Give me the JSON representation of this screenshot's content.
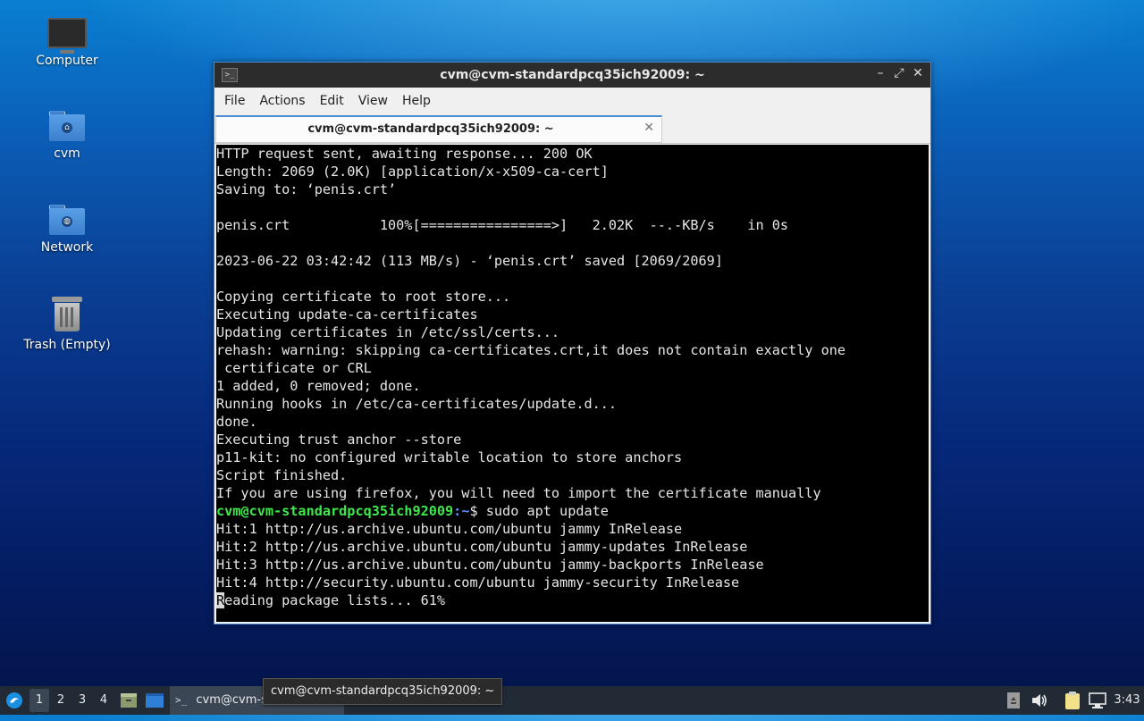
{
  "desktop": {
    "icons": [
      {
        "label": "Computer"
      },
      {
        "label": "cvm"
      },
      {
        "label": "Network"
      },
      {
        "label": "Trash (Empty)"
      }
    ]
  },
  "window": {
    "title": "cvm@cvm-standardpcq35ich92009: ~",
    "menu": [
      "File",
      "Actions",
      "Edit",
      "View",
      "Help"
    ],
    "tab_label": "cvm@cvm-standardpcq35ich92009: ~",
    "tab_close": "✕",
    "controls": {
      "minimize": "–",
      "maximize": "⤢",
      "close": "✕"
    }
  },
  "terminal": {
    "lines": [
      "HTTP request sent, awaiting response... 200 OK",
      "Length: 2069 (2.0K) [application/x-x509-ca-cert]",
      "Saving to: ‘penis.crt’",
      "",
      "penis.crt           100%[================>]   2.02K  --.-KB/s    in 0s",
      "",
      "2023-06-22 03:42:42 (113 MB/s) - ‘penis.crt’ saved [2069/2069]",
      "",
      "Copying certificate to root store...",
      "Executing update-ca-certificates",
      "Updating certificates in /etc/ssl/certs...",
      "rehash: warning: skipping ca-certificates.crt,it does not contain exactly one",
      " certificate or CRL",
      "1 added, 0 removed; done.",
      "Running hooks in /etc/ca-certificates/update.d...",
      "done.",
      "Executing trust anchor --store",
      "p11-kit: no configured writable location to store anchors",
      "Script finished.",
      "If you are using firefox, you will need to import the certificate manually"
    ],
    "prompt_user": "cvm@cvm-standardpcq35ich92009",
    "prompt_path": ":~",
    "prompt_sym": "$ ",
    "command": "sudo apt update",
    "after_lines": [
      "Hit:1 http://us.archive.ubuntu.com/ubuntu jammy InRelease",
      "Hit:2 http://us.archive.ubuntu.com/ubuntu jammy-updates InRelease",
      "Hit:3 http://us.archive.ubuntu.com/ubuntu jammy-backports InRelease",
      "Hit:4 http://security.ubuntu.com/ubuntu jammy-security InRelease"
    ],
    "cursor_char": "R",
    "last_line_rest": "eading package lists... 61%"
  },
  "taskbar": {
    "workspaces": [
      "1",
      "2",
      "3",
      "4"
    ],
    "task_label": "cvm@cvm-s",
    "clock": "3:43",
    "tooltip": "cvm@cvm-standardpcq35ich92009: ~"
  },
  "colors": {
    "prompt": "#3ee84a",
    "path": "#5c8ef2",
    "terminal_bg": "#000000",
    "window_border": "#4a8bd6"
  }
}
